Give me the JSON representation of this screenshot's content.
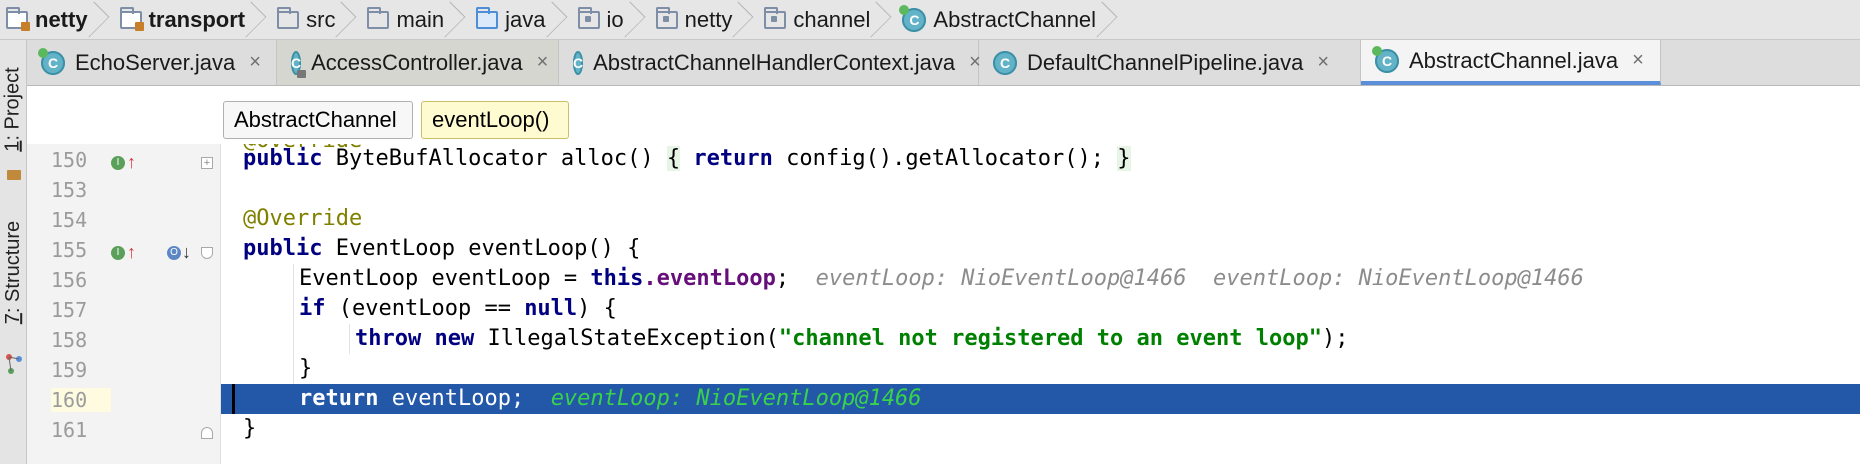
{
  "breadcrumb": [
    {
      "label": "netty",
      "icon": "module-folder-icon",
      "bold": true
    },
    {
      "label": "transport",
      "icon": "module-folder-icon",
      "bold": true
    },
    {
      "label": "src",
      "icon": "folder-icon",
      "bold": false
    },
    {
      "label": "main",
      "icon": "folder-icon",
      "bold": false
    },
    {
      "label": "java",
      "icon": "source-folder-icon",
      "bold": false
    },
    {
      "label": "io",
      "icon": "package-icon",
      "bold": false
    },
    {
      "label": "netty",
      "icon": "package-icon",
      "bold": false
    },
    {
      "label": "channel",
      "icon": "package-icon",
      "bold": false
    },
    {
      "label": "AbstractChannel",
      "icon": "class-icon",
      "bold": false
    }
  ],
  "tabs": [
    {
      "label": "EchoServer.java",
      "close": "×",
      "active": false
    },
    {
      "label": "AccessController.java",
      "close": "×",
      "active": false
    },
    {
      "label": "AbstractChannelHandlerContext.java",
      "close": "×",
      "active": false
    },
    {
      "label": "DefaultChannelPipeline.java",
      "close": "×",
      "active": false
    },
    {
      "label": "AbstractChannel.java",
      "close": "×",
      "active": true
    }
  ],
  "toolwindows": {
    "project": {
      "num": "1",
      "label": ": Project"
    },
    "structure": {
      "num": "7",
      "label": ": Structure"
    }
  },
  "editor_breadcrumb": {
    "class_chip": "AbstractChannel",
    "method_chip": "eventLoop()"
  },
  "code": {
    "partial_top_text": "@Override",
    "lines": [
      {
        "num": "150"
      },
      {
        "num": "153"
      },
      {
        "num": "154"
      },
      {
        "num": "155"
      },
      {
        "num": "156"
      },
      {
        "num": "157"
      },
      {
        "num": "158"
      },
      {
        "num": "159"
      },
      {
        "num": "160"
      },
      {
        "num": "161"
      }
    ],
    "tokens": {
      "public": "public",
      "bytebuf_type": "ByteBufAllocator",
      "alloc_sig": "alloc()",
      "open_brace": "{",
      "return": "return",
      "config_call": "config().getAllocator();",
      "close_brace": "}",
      "override": "@Override",
      "eventloop_type": "EventLoop",
      "eventloop_sig": "eventLoop() {",
      "eventloop_decl": "eventLoop =",
      "this": "this",
      "field_access": ".eventLoop",
      "semicolon": ";",
      "if": "if",
      "if_cond": "(eventLoop ==",
      "null": "null",
      "if_end": ") {",
      "throw": "throw",
      "new": "new",
      "exception_class": "IllegalStateException(",
      "exception_msg": "\"channel not registered to an event loop\"",
      "exception_end": ");",
      "return_value": "eventLoop;"
    },
    "inline_hints": {
      "line156_a": "eventLoop: NioEventLoop@1466",
      "line156_b": "eventLoop: NioEventLoop@1466",
      "line160": "eventLoop: NioEventLoop@1466"
    },
    "execution_line": "160"
  },
  "colors": {
    "keyword": "#000080",
    "annotation": "#808000",
    "field": "#660e7a",
    "string": "#008000",
    "execution_highlight": "#2357a8",
    "hint_on_exec": "#38d34a"
  }
}
